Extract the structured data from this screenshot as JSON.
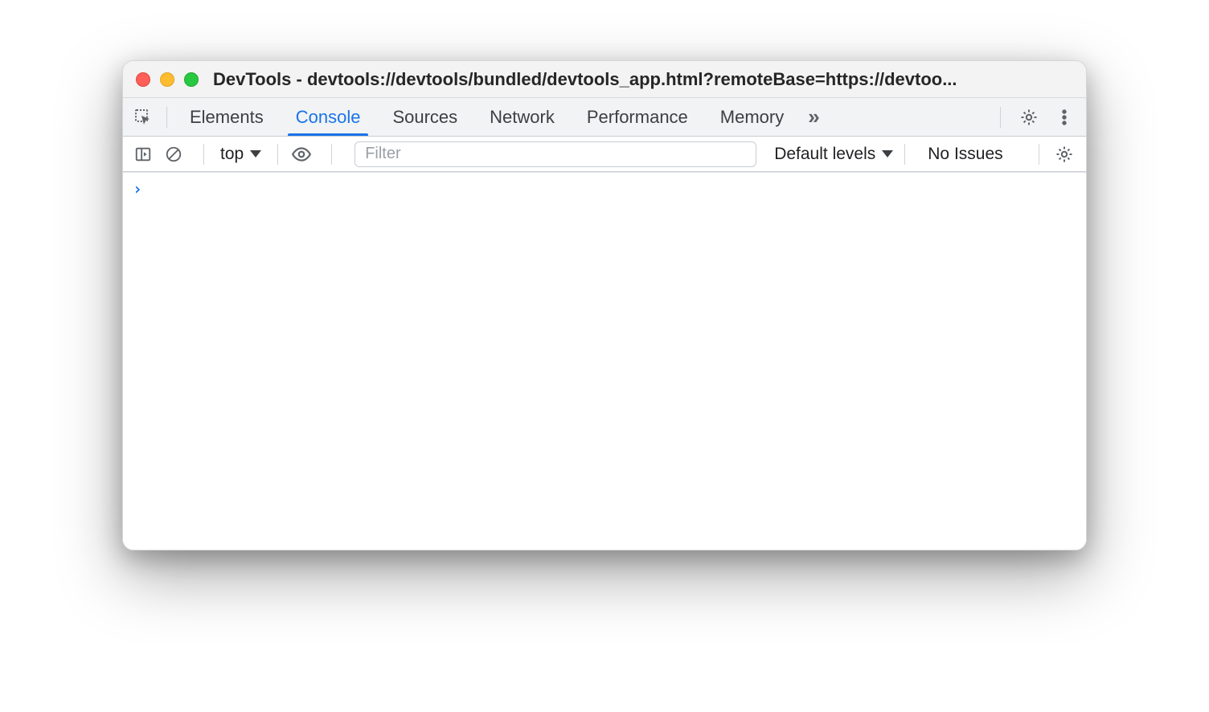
{
  "window": {
    "title": "DevTools - devtools://devtools/bundled/devtools_app.html?remoteBase=https://devtoo..."
  },
  "tabs": {
    "items": [
      {
        "label": "Elements",
        "active": false
      },
      {
        "label": "Console",
        "active": true
      },
      {
        "label": "Sources",
        "active": false
      },
      {
        "label": "Network",
        "active": false
      },
      {
        "label": "Performance",
        "active": false
      },
      {
        "label": "Memory",
        "active": false
      }
    ],
    "overflow_glyph": "»"
  },
  "console_toolbar": {
    "context_label": "top",
    "filter_placeholder": "Filter",
    "levels_label": "Default levels",
    "issues_label": "No Issues"
  },
  "console": {
    "prompt_glyph": "›"
  }
}
